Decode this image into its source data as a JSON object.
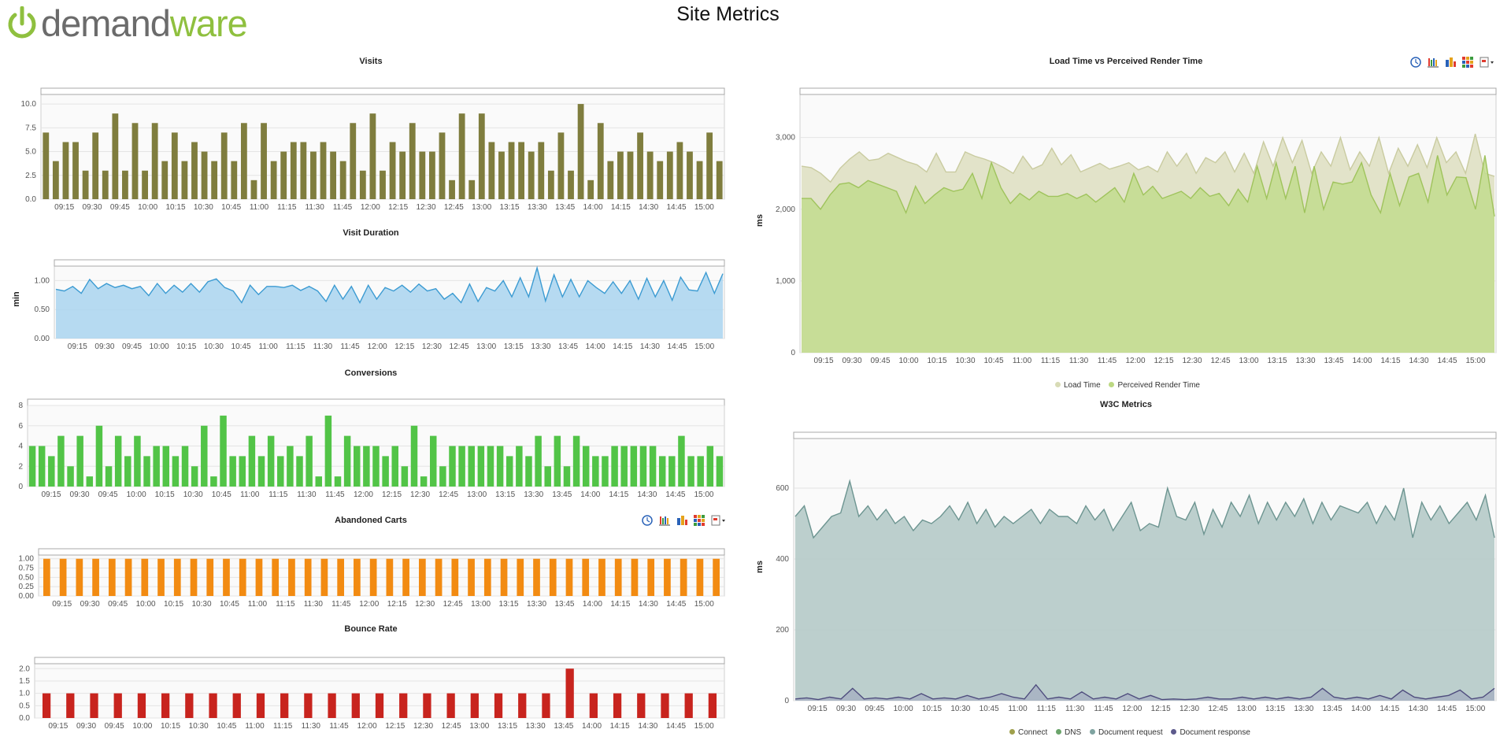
{
  "header": {
    "logo_text_a": "demand",
    "logo_text_b": "ware",
    "title": "Site Metrics"
  },
  "colors": {
    "visits": "#7f7d3e",
    "visit_duration": "#4aa3d8",
    "conversions": "#52c447",
    "abandoned": "#f28b12",
    "bounce": "#c8241e",
    "load_time": "#d8dbb6",
    "render_time": "#bcd882",
    "document_request": "#9fb9b7"
  },
  "toolbar_icons": [
    "clock-icon",
    "bar-chart-icon",
    "column-chart-icon",
    "heatmap-icon",
    "export-menu-icon"
  ],
  "chart_data": [
    {
      "id": "visits",
      "type": "bar",
      "title": "Visits",
      "ylabel": "",
      "ylim": [
        0,
        11
      ],
      "yticks": [
        "0.0",
        "2.5",
        "5.0",
        "7.5",
        "10.0"
      ],
      "xticks": [
        "09:15",
        "09:30",
        "09:45",
        "10:00",
        "10:15",
        "10:30",
        "10:45",
        "11:00",
        "11:15",
        "11:30",
        "11:45",
        "12:00",
        "12:15",
        "12:30",
        "12:45",
        "13:00",
        "13:15",
        "13:30",
        "13:45",
        "14:00",
        "14:15",
        "14:30",
        "14:45",
        "15:00"
      ],
      "values": [
        7,
        4,
        6,
        6,
        3,
        7,
        3,
        9,
        3,
        8,
        3,
        8,
        4,
        7,
        4,
        6,
        5,
        4,
        7,
        4,
        8,
        2,
        8,
        4,
        5,
        6,
        6,
        5,
        6,
        5,
        4,
        8,
        3,
        9,
        3,
        6,
        5,
        8,
        5,
        5,
        7,
        2,
        9,
        2,
        9,
        6,
        5,
        6,
        6,
        5,
        6,
        3,
        7,
        3,
        10,
        2,
        8,
        4,
        5,
        5,
        7,
        5,
        4,
        5,
        6,
        5,
        4,
        7,
        4
      ],
      "grid": true
    },
    {
      "id": "visit_duration",
      "type": "area",
      "title": "Visit Duration",
      "ylabel": "min",
      "ylim": [
        0,
        1.25
      ],
      "yticks": [
        "0.00",
        "0.50",
        "1.00"
      ],
      "xticks": [
        "09:15",
        "09:30",
        "09:45",
        "10:00",
        "10:15",
        "10:30",
        "10:45",
        "11:00",
        "11:15",
        "11:30",
        "11:45",
        "12:00",
        "12:15",
        "12:30",
        "12:45",
        "13:00",
        "13:15",
        "13:30",
        "13:45",
        "14:00",
        "14:15",
        "14:30",
        "14:45",
        "15:00"
      ],
      "values": [
        0.85,
        0.82,
        0.9,
        0.78,
        1.02,
        0.86,
        0.95,
        0.88,
        0.92,
        0.86,
        0.9,
        0.74,
        0.95,
        0.78,
        0.92,
        0.8,
        0.95,
        0.8,
        0.98,
        1.03,
        0.88,
        0.82,
        0.62,
        0.92,
        0.76,
        0.9,
        0.9,
        0.88,
        0.92,
        0.83,
        0.9,
        0.82,
        0.64,
        0.92,
        0.68,
        0.9,
        0.62,
        0.92,
        0.68,
        0.88,
        0.82,
        0.92,
        0.8,
        0.94,
        0.82,
        0.86,
        0.68,
        0.78,
        0.62,
        0.94,
        0.64,
        0.88,
        0.82,
        1.0,
        0.72,
        1.05,
        0.72,
        1.22,
        0.65,
        1.1,
        0.72,
        1.02,
        0.72,
        1.0,
        0.88,
        0.78,
        0.98,
        0.78,
        1.0,
        0.68,
        1.04,
        0.72,
        1.0,
        0.66,
        1.06,
        0.84,
        0.82,
        1.14,
        0.78,
        1.12
      ],
      "grid": true
    },
    {
      "id": "conversions",
      "type": "bar",
      "title": "Conversions",
      "ylabel": "",
      "ylim": [
        0,
        8
      ],
      "yticks": [
        "0",
        "2",
        "4",
        "6",
        "8"
      ],
      "xticks": [
        "09:15",
        "09:30",
        "09:45",
        "10:00",
        "10:15",
        "10:30",
        "10:45",
        "11:00",
        "11:15",
        "11:30",
        "11:45",
        "12:00",
        "12:15",
        "12:30",
        "12:45",
        "13:00",
        "13:15",
        "13:30",
        "13:45",
        "14:00",
        "14:15",
        "14:30",
        "14:45",
        "15:00"
      ],
      "values": [
        4,
        4,
        3,
        5,
        2,
        5,
        1,
        6,
        2,
        5,
        3,
        5,
        3,
        4,
        4,
        3,
        4,
        2,
        6,
        1,
        7,
        3,
        3,
        5,
        3,
        5,
        3,
        4,
        3,
        5,
        1,
        7,
        1,
        5,
        4,
        4,
        4,
        3,
        4,
        2,
        6,
        1,
        5,
        2,
        4,
        4,
        4,
        4,
        4,
        4,
        3,
        4,
        3,
        5,
        2,
        5,
        2,
        5,
        4,
        3,
        3,
        4,
        4,
        4,
        4,
        4,
        3,
        3,
        5,
        3,
        3,
        4,
        3
      ],
      "grid": true
    },
    {
      "id": "abandoned_carts",
      "type": "bar",
      "title": "Abandoned Carts",
      "ylabel": "",
      "ylim": [
        0,
        1.1
      ],
      "yticks": [
        "0.00",
        "0.25",
        "0.50",
        "0.75",
        "1.00"
      ],
      "xticks": [
        "09:15",
        "09:30",
        "09:45",
        "10:00",
        "10:15",
        "10:30",
        "10:45",
        "11:00",
        "11:15",
        "11:30",
        "11:45",
        "12:00",
        "12:15",
        "12:30",
        "12:45",
        "13:00",
        "13:15",
        "13:30",
        "13:45",
        "14:00",
        "14:15",
        "14:30",
        "14:45",
        "15:00"
      ],
      "values": [
        1,
        1,
        1,
        1,
        1,
        1,
        1,
        1,
        1,
        1,
        1,
        1,
        1,
        1,
        1,
        1,
        1,
        1,
        1,
        1,
        1,
        1,
        1,
        1,
        1,
        1,
        1,
        1,
        1,
        1,
        1,
        1,
        1,
        1,
        1,
        1,
        1,
        1,
        1,
        1,
        1,
        1
      ],
      "grid": true
    },
    {
      "id": "bounce_rate",
      "type": "bar",
      "title": "Bounce Rate",
      "ylabel": "",
      "ylim": [
        0,
        2.2
      ],
      "yticks": [
        "0.0",
        "0.5",
        "1.0",
        "1.5",
        "2.0"
      ],
      "xticks": [
        "09:15",
        "09:30",
        "09:45",
        "10:00",
        "10:15",
        "10:30",
        "10:45",
        "11:00",
        "11:15",
        "11:30",
        "11:45",
        "12:00",
        "12:15",
        "12:30",
        "12:45",
        "13:00",
        "13:15",
        "13:30",
        "13:45",
        "14:00",
        "14:15",
        "14:30",
        "14:45",
        "15:00"
      ],
      "values": [
        1,
        1,
        1,
        1,
        1,
        1,
        1,
        1,
        1,
        1,
        1,
        1,
        1,
        1,
        1,
        1,
        1,
        1,
        1,
        1,
        1,
        1,
        2,
        1,
        1,
        1,
        1,
        1,
        1
      ],
      "grid": true
    },
    {
      "id": "load_vs_render",
      "type": "area",
      "title": "Load Time vs Perceived Render Time",
      "ylabel": "ms",
      "ylim": [
        0,
        3600
      ],
      "yticks": [
        "0",
        "1,000",
        "2,000",
        "3,000"
      ],
      "xticks": [
        "09:15",
        "09:30",
        "09:45",
        "10:00",
        "10:15",
        "10:30",
        "10:45",
        "11:00",
        "11:15",
        "11:30",
        "11:45",
        "12:00",
        "12:15",
        "12:30",
        "12:45",
        "13:00",
        "13:15",
        "13:30",
        "13:45",
        "14:00",
        "14:15",
        "14:30",
        "14:45",
        "15:00"
      ],
      "legend": [
        "Load Time",
        "Perceived Render Time"
      ],
      "legend_position": "bottom",
      "series": [
        {
          "name": "Load Time",
          "values": [
            2600,
            2580,
            2500,
            2380,
            2570,
            2700,
            2800,
            2680,
            2700,
            2780,
            2720,
            2660,
            2620,
            2520,
            2780,
            2520,
            2520,
            2800,
            2740,
            2700,
            2650,
            2580,
            2500,
            2740,
            2560,
            2620,
            2850,
            2620,
            2760,
            2520,
            2580,
            2640,
            2560,
            2600,
            2650,
            2550,
            2600,
            2520,
            2800,
            2600,
            2780,
            2500,
            2720,
            2650,
            2800,
            2520,
            2780,
            2500,
            2940,
            2600,
            3000,
            2650,
            2960,
            2500,
            2800,
            2600,
            3000,
            2550,
            2800,
            2600,
            3000,
            2500,
            2850,
            2600,
            2900,
            2580,
            3000,
            2650,
            2800,
            2500,
            3050,
            2500,
            2460
          ]
        },
        {
          "name": "Perceived Render Time",
          "values": [
            2150,
            2150,
            2000,
            2200,
            2350,
            2370,
            2300,
            2400,
            2350,
            2300,
            2250,
            1950,
            2320,
            2080,
            2200,
            2300,
            2250,
            2280,
            2500,
            2150,
            2650,
            2300,
            2080,
            2220,
            2130,
            2250,
            2180,
            2180,
            2220,
            2150,
            2210,
            2100,
            2200,
            2300,
            2100,
            2500,
            2200,
            2320,
            2150,
            2200,
            2250,
            2150,
            2300,
            2180,
            2220,
            2050,
            2280,
            2100,
            2600,
            2150,
            2650,
            2150,
            2600,
            1950,
            2600,
            2000,
            2380,
            2350,
            2380,
            2650,
            2200,
            1950,
            2500,
            2050,
            2450,
            2500,
            2100,
            2750,
            2200,
            2450,
            2440,
            2000,
            2750,
            1900
          ]
        }
      ],
      "grid": true
    },
    {
      "id": "w3c_metrics",
      "type": "area",
      "title": "W3C Metrics",
      "ylabel": "ms",
      "ylim": [
        0,
        740
      ],
      "yticks": [
        "0",
        "200",
        "400",
        "600"
      ],
      "xticks": [
        "09:15",
        "09:30",
        "09:45",
        "10:00",
        "10:15",
        "10:30",
        "10:45",
        "11:00",
        "11:15",
        "11:30",
        "11:45",
        "12:00",
        "12:15",
        "12:30",
        "12:45",
        "13:00",
        "13:15",
        "13:30",
        "13:45",
        "14:00",
        "14:15",
        "14:30",
        "14:45",
        "15:00"
      ],
      "legend": [
        "Connect",
        "DNS",
        "Document request",
        "Document response"
      ],
      "legend_position": "bottom",
      "series": [
        {
          "name": "Document request",
          "values": [
            520,
            550,
            460,
            490,
            520,
            530,
            620,
            520,
            550,
            510,
            540,
            500,
            520,
            480,
            510,
            500,
            520,
            550,
            510,
            560,
            500,
            540,
            490,
            520,
            500,
            520,
            540,
            500,
            540,
            520,
            520,
            500,
            550,
            510,
            540,
            480,
            520,
            560,
            480,
            500,
            490,
            600,
            520,
            510,
            560,
            470,
            540,
            490,
            560,
            520,
            580,
            500,
            560,
            510,
            560,
            520,
            570,
            500,
            560,
            510,
            550,
            540,
            530,
            560,
            500,
            550,
            510,
            600,
            460,
            560,
            510,
            550,
            500,
            530,
            560,
            510,
            580,
            460
          ]
        },
        {
          "name": "Document response",
          "values": [
            5,
            8,
            3,
            10,
            5,
            35,
            5,
            8,
            5,
            10,
            5,
            20,
            5,
            8,
            5,
            15,
            5,
            10,
            20,
            10,
            5,
            45,
            5,
            10,
            5,
            25,
            5,
            10,
            5,
            20,
            5,
            15,
            3,
            5,
            3,
            5,
            10,
            5,
            5,
            10,
            5,
            10,
            5,
            10,
            5,
            10,
            35,
            10,
            5,
            10,
            5,
            15,
            5,
            30,
            10,
            5,
            10,
            15,
            30,
            5,
            10,
            35
          ]
        }
      ],
      "grid": true
    }
  ]
}
